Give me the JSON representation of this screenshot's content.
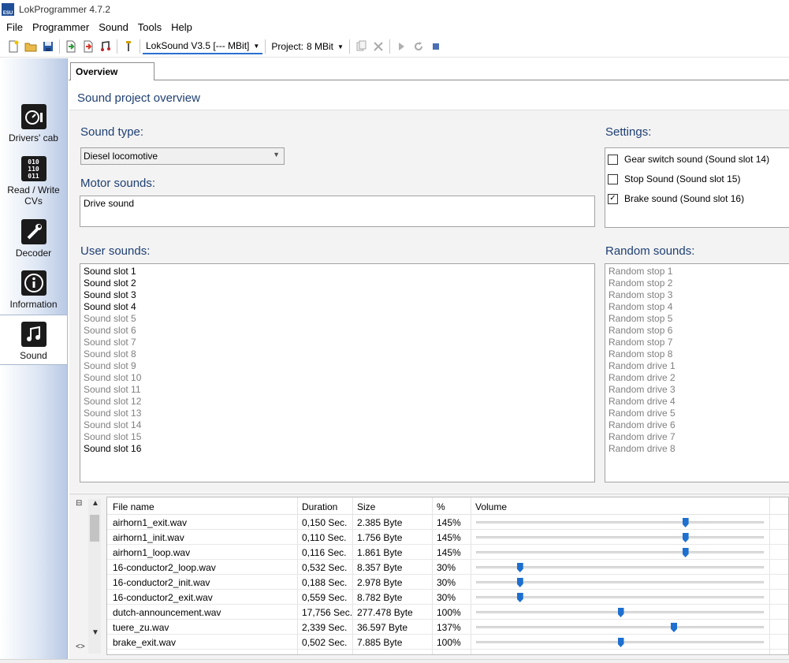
{
  "window": {
    "title": "LokProgrammer 4.7.2",
    "app_icon_text": "ESU"
  },
  "menu": [
    "File",
    "Programmer",
    "Sound",
    "Tools",
    "Help"
  ],
  "toolbar": {
    "device": "LokSound V3.5 [--- MBit]",
    "project_label": "Project:",
    "project_value": "8 MBit",
    "icons": [
      "new-file-icon",
      "open-folder-icon",
      "save-icon",
      "import-icon",
      "export-icon",
      "play-sound-icon",
      "wrench-icon",
      "copy-icon",
      "delete-icon",
      "play-icon",
      "reload-icon",
      "stop-icon"
    ]
  },
  "sidebar": [
    {
      "label": "Drivers' cab",
      "icon": "gauge-icon"
    },
    {
      "label": "Read / Write CVs",
      "icon": "binary-icon"
    },
    {
      "label": "Decoder",
      "icon": "wrench-icon"
    },
    {
      "label": "Information",
      "icon": "info-icon"
    },
    {
      "label": "Sound",
      "icon": "music-note-icon",
      "active": true
    }
  ],
  "tab": "Overview",
  "overview": {
    "title": "Sound project overview",
    "sound_type_label": "Sound type:",
    "sound_type_value": "Diesel locomotive",
    "motor_label": "Motor sounds:",
    "motor_sounds": [
      "Drive sound"
    ],
    "settings_label": "Settings:",
    "settings": [
      {
        "label": "Gear switch sound (Sound slot 14)",
        "checked": false
      },
      {
        "label": "Stop Sound (Sound slot 15)",
        "checked": false
      },
      {
        "label": "Brake sound (Sound slot 16)",
        "checked": true
      }
    ],
    "user_label": "User sounds:",
    "user_sounds": [
      {
        "label": "Sound slot 1",
        "active": true
      },
      {
        "label": "Sound slot 2",
        "active": true
      },
      {
        "label": "Sound slot 3",
        "active": true
      },
      {
        "label": "Sound slot 4",
        "active": true
      },
      {
        "label": "Sound slot 5",
        "active": false
      },
      {
        "label": "Sound slot 6",
        "active": false
      },
      {
        "label": "Sound slot 7",
        "active": false
      },
      {
        "label": "Sound slot 8",
        "active": false
      },
      {
        "label": "Sound slot 9",
        "active": false
      },
      {
        "label": "Sound slot 10",
        "active": false
      },
      {
        "label": "Sound slot 11",
        "active": false
      },
      {
        "label": "Sound slot 12",
        "active": false
      },
      {
        "label": "Sound slot 13",
        "active": false
      },
      {
        "label": "Sound slot 14",
        "active": false
      },
      {
        "label": "Sound slot 15",
        "active": false
      },
      {
        "label": "Sound slot 16",
        "active": true
      }
    ],
    "random_label": "Random sounds:",
    "random_sounds": [
      "Random stop 1",
      "Random stop 2",
      "Random stop 3",
      "Random stop 4",
      "Random stop 5",
      "Random stop 6",
      "Random stop 7",
      "Random stop 8",
      "Random drive 1",
      "Random drive 2",
      "Random drive 3",
      "Random drive 4",
      "Random drive 5",
      "Random drive 6",
      "Random drive 7",
      "Random drive 8"
    ]
  },
  "files": {
    "columns": [
      "File name",
      "Duration",
      "Size",
      "%",
      "Volume"
    ],
    "rows": [
      {
        "name": "airhorn1_exit.wav",
        "duration": "0,150 Sec.",
        "size": "2.385 Byte",
        "percent": "145%",
        "volume": 145
      },
      {
        "name": "airhorn1_init.wav",
        "duration": "0,110 Sec.",
        "size": "1.756 Byte",
        "percent": "145%",
        "volume": 145
      },
      {
        "name": "airhorn1_loop.wav",
        "duration": "0,116 Sec.",
        "size": "1.861 Byte",
        "percent": "145%",
        "volume": 145
      },
      {
        "name": "16-conductor2_loop.wav",
        "duration": "0,532 Sec.",
        "size": "8.357 Byte",
        "percent": "30%",
        "volume": 30
      },
      {
        "name": "16-conductor2_init.wav",
        "duration": "0,188 Sec.",
        "size": "2.978 Byte",
        "percent": "30%",
        "volume": 30
      },
      {
        "name": "16-conductor2_exit.wav",
        "duration": "0,559 Sec.",
        "size": "8.782 Byte",
        "percent": "30%",
        "volume": 30
      },
      {
        "name": "dutch-announcement.wav",
        "duration": "17,756 Sec.",
        "size": "277.478 Byte",
        "percent": "100%",
        "volume": 100
      },
      {
        "name": "tuere_zu.wav",
        "duration": "2,339 Sec.",
        "size": "36.597 Byte",
        "percent": "137%",
        "volume": 137
      },
      {
        "name": "brake_exit.wav",
        "duration": "0,502 Sec.",
        "size": "7.885 Byte",
        "percent": "100%",
        "volume": 100
      }
    ]
  }
}
